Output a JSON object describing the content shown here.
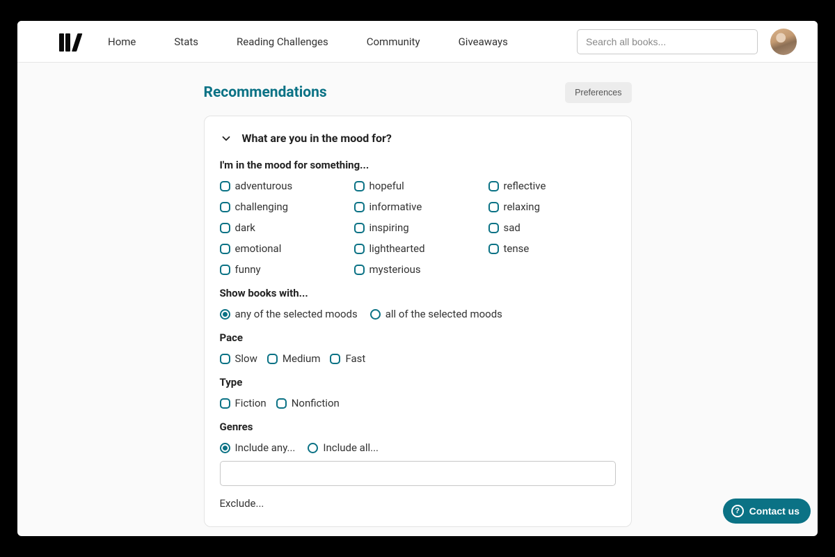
{
  "nav": {
    "links": [
      "Home",
      "Stats",
      "Reading Challenges",
      "Community",
      "Giveaways"
    ],
    "search_placeholder": "Search all books..."
  },
  "page": {
    "title": "Recommendations",
    "preferences_button": "Preferences"
  },
  "accordion": {
    "title": "What are you in the mood for?"
  },
  "mood": {
    "label": "I'm in the mood for something...",
    "options": [
      "adventurous",
      "hopeful",
      "reflective",
      "challenging",
      "informative",
      "relaxing",
      "dark",
      "inspiring",
      "sad",
      "emotional",
      "lighthearted",
      "tense",
      "funny",
      "mysterious"
    ]
  },
  "showBooks": {
    "label": "Show books with...",
    "options": [
      "any of the selected moods",
      "all of the selected moods"
    ],
    "selected": "any of the selected moods"
  },
  "pace": {
    "label": "Pace",
    "options": [
      "Slow",
      "Medium",
      "Fast"
    ]
  },
  "type": {
    "label": "Type",
    "options": [
      "Fiction",
      "Nonfiction"
    ]
  },
  "genres": {
    "label": "Genres",
    "include_options": [
      "Include any...",
      "Include all..."
    ],
    "include_selected": "Include any...",
    "exclude_label": "Exclude..."
  },
  "contact": {
    "label": "Contact us"
  },
  "colors": {
    "accent": "#0b7285"
  }
}
